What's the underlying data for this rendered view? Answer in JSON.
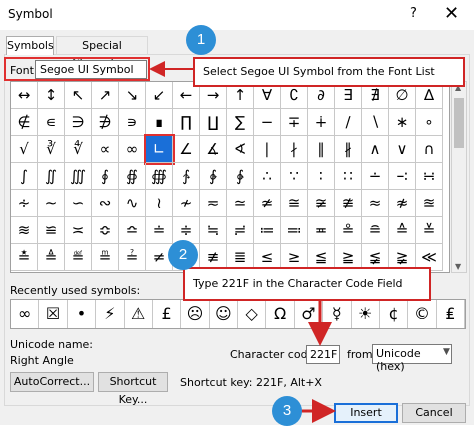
{
  "window": {
    "title": "Symbol",
    "help_glyph": "?",
    "close_glyph": "✕"
  },
  "tabs": [
    {
      "label": "Symbols"
    },
    {
      "label": "Special Characters"
    }
  ],
  "font": {
    "label": "Font:",
    "value": "Segoe UI Symbol"
  },
  "grid": {
    "rows": [
      [
        "↔",
        "↕",
        "↖",
        "↗",
        "↘",
        "↙",
        "←",
        "→",
        "↑",
        "∀",
        "∁",
        "∂",
        "∃",
        "∄",
        "∅",
        "∆"
      ],
      [
        "∉",
        "∊",
        "∋",
        "∌",
        "∍",
        "∎",
        "∏",
        "∐",
        "∑",
        "−",
        "∓",
        "∔",
        "∕",
        "∖",
        "∗",
        "∘"
      ],
      [
        "√",
        "∛",
        "∜",
        "∝",
        "∞",
        "∟",
        "∠",
        "∡",
        "∢",
        "∣",
        "∤",
        "∥",
        "∦",
        "∧",
        "∨",
        "∩"
      ],
      [
        "∫",
        "∬",
        "∭",
        "∮",
        "∯",
        "∰",
        "∱",
        "∲",
        "∳",
        "∴",
        "∵",
        "∶",
        "∷",
        "∸",
        "∹",
        "∺"
      ],
      [
        "∻",
        "∼",
        "∽",
        "∾",
        "∿",
        "≀",
        "≁",
        "≂",
        "≃",
        "≄",
        "≅",
        "≆",
        "≇",
        "≈",
        "≉",
        "≊"
      ],
      [
        "≋",
        "≌",
        "≍",
        "≎",
        "≏",
        "≐",
        "≑",
        "≒",
        "≓",
        "≔",
        "≕",
        "≖",
        "≗",
        "≘",
        "≙",
        "≚"
      ],
      [
        "≛",
        "≜",
        "≝",
        "≞",
        "≟",
        "≠",
        "≡",
        "≢",
        "≣",
        "≤",
        "≥",
        "≦",
        "≧",
        "≨",
        "≩",
        "≪"
      ]
    ],
    "selected_row": 2,
    "selected_col": 5
  },
  "recent": {
    "label": "Recently used symbols:",
    "symbols": [
      "∞",
      "☒",
      "•",
      "⚡",
      "⚠",
      "£",
      "☹",
      "☺",
      "◇",
      "Ω",
      "♂",
      "☿",
      "☀",
      "¢",
      "©",
      "₤"
    ]
  },
  "unicode_name": {
    "label": "Unicode name:",
    "value": "Right Angle"
  },
  "character_code": {
    "label": "Character code:",
    "value": "221F"
  },
  "from": {
    "label": "from:",
    "value": "Unicode (hex)"
  },
  "buttons": {
    "autocorrect": "AutoCorrect...",
    "shortcut_key": "Shortcut Key...",
    "insert": "Insert",
    "cancel": "Cancel"
  },
  "shortcut_text": "Shortcut key: 221F, Alt+X",
  "callouts": [
    {
      "number": "1",
      "text": "Select Segoe UI Symbol from the Font List"
    },
    {
      "number": "2",
      "text": "Type 221F in the Character Code Field"
    },
    {
      "number": "3"
    }
  ],
  "colors": {
    "accent": "#1a6fd8",
    "callout_border": "#d02525",
    "badge": "#2d8fd6"
  }
}
